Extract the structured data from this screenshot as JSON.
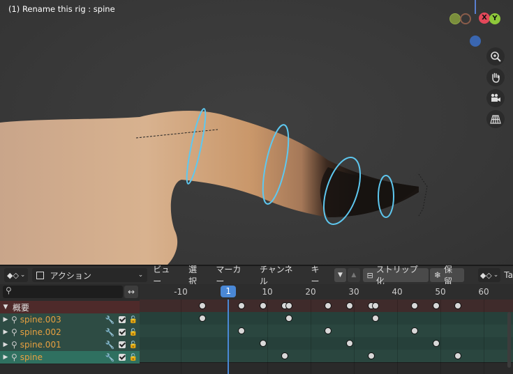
{
  "viewport": {
    "title": "(1) Rename this rig : spine",
    "gizmo": {
      "x_label": "X",
      "y_label": "Y"
    },
    "nav_icons": [
      "zoom-icon",
      "hand-pan-icon",
      "camera-icon",
      "perspective-grid-icon"
    ]
  },
  "header": {
    "mode_label": "アクション",
    "menus": [
      "ビュー",
      "選択",
      "マーカー",
      "チャンネル",
      "キー"
    ],
    "strip_label": "ストリップ化",
    "stash_label": "保留",
    "truncated_label": "Ta"
  },
  "ruler": {
    "ticks": [
      {
        "label": "-10",
        "frame": -10
      },
      {
        "label": "10",
        "frame": 10
      },
      {
        "label": "20",
        "frame": 20
      },
      {
        "label": "30",
        "frame": 30
      },
      {
        "label": "40",
        "frame": 40
      },
      {
        "label": "50",
        "frame": 50
      },
      {
        "label": "60",
        "frame": 60
      }
    ],
    "current_frame": "1"
  },
  "channels": [
    {
      "name": "概要",
      "kind": "summary",
      "keyframes": [
        -5,
        4,
        9,
        14,
        15,
        24,
        29,
        34,
        35,
        44,
        49,
        54
      ]
    },
    {
      "name": "spine.003",
      "kind": "bone",
      "keyframes": [
        -5,
        15,
        35
      ]
    },
    {
      "name": "spine.002",
      "kind": "bone",
      "keyframes": [
        4,
        24,
        44
      ]
    },
    {
      "name": "spine.001",
      "kind": "bone",
      "keyframes": [
        9,
        29,
        49
      ]
    },
    {
      "name": "spine",
      "kind": "bone-selected",
      "keyframes": [
        14,
        34,
        54
      ]
    }
  ],
  "colors": {
    "accent": "#4a88d6",
    "summary_row": "#4e2a2a",
    "channel_row": "#2e4c44",
    "selected_row": "#2f7060",
    "channel_text": "#e8a040",
    "bone_ring": "#5ec8f0"
  }
}
